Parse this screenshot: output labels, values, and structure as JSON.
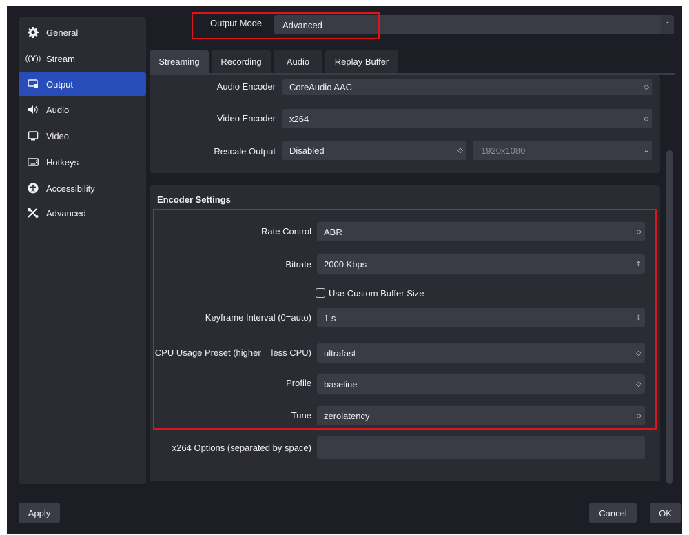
{
  "sidebar": {
    "items": [
      {
        "label": "General",
        "icon": "gear-icon"
      },
      {
        "label": "Stream",
        "icon": "antenna-icon"
      },
      {
        "label": "Output",
        "icon": "output-icon"
      },
      {
        "label": "Audio",
        "icon": "speaker-icon"
      },
      {
        "label": "Video",
        "icon": "monitor-icon"
      },
      {
        "label": "Hotkeys",
        "icon": "keyboard-icon"
      },
      {
        "label": "Accessibility",
        "icon": "accessibility-icon"
      },
      {
        "label": "Advanced",
        "icon": "tools-icon"
      }
    ],
    "active": "Output"
  },
  "output_mode": {
    "label": "Output Mode",
    "value": "Advanced"
  },
  "tabs": [
    "Streaming",
    "Recording",
    "Audio",
    "Replay Buffer"
  ],
  "active_tab": "Streaming",
  "streaming": {
    "audio_encoder": {
      "label": "Audio Encoder",
      "value": "CoreAudio AAC"
    },
    "video_encoder": {
      "label": "Video Encoder",
      "value": "x264"
    },
    "rescale_output": {
      "label": "Rescale Output",
      "value": "Disabled",
      "resolution": "1920x1080"
    }
  },
  "encoder_settings": {
    "title": "Encoder Settings",
    "rate_control": {
      "label": "Rate Control",
      "value": "ABR"
    },
    "bitrate": {
      "label": "Bitrate",
      "value": "2000 Kbps"
    },
    "custom_buffer": {
      "label": "Use Custom Buffer Size",
      "checked": false
    },
    "keyframe": {
      "label": "Keyframe Interval (0=auto)",
      "value": "1 s"
    },
    "cpu_preset": {
      "label": "CPU Usage Preset (higher = less CPU)",
      "value": "ultrafast"
    },
    "profile": {
      "label": "Profile",
      "value": "baseline"
    },
    "tune": {
      "label": "Tune",
      "value": "zerolatency"
    },
    "x264_options": {
      "label": "x264 Options (separated by space)",
      "value": ""
    }
  },
  "buttons": {
    "apply": "Apply",
    "cancel": "Cancel",
    "ok": "OK"
  },
  "colors": {
    "highlight": "#e0121a",
    "active": "#284cb8"
  }
}
